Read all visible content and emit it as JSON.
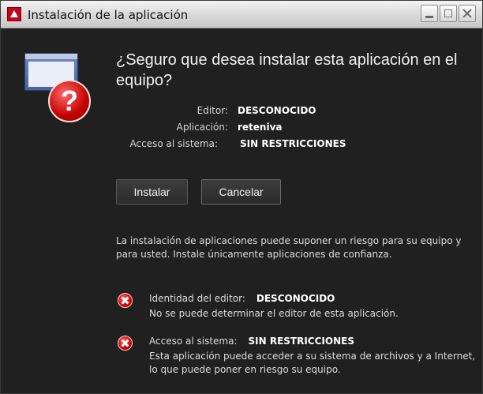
{
  "window": {
    "title": "Instalación de la aplicación"
  },
  "prompt": {
    "question": "¿Seguro que desea instalar esta aplicación en el equipo?"
  },
  "details": [
    {
      "label": "Editor:",
      "value": "DESCONOCIDO"
    },
    {
      "label": "Aplicación:",
      "value": "reteniva"
    },
    {
      "label": "Acceso al sistema:",
      "value": "SIN RESTRICCIONES"
    }
  ],
  "buttons": {
    "install": "Instalar",
    "cancel": "Cancelar"
  },
  "warning": "La instalación de aplicaciones puede suponer un riesgo para su equipo y para usted. Instale únicamente aplicaciones de confianza.",
  "risks": [
    {
      "label": "Identidad del editor:",
      "value": "DESCONOCIDO",
      "description": "No se puede determinar el editor de esta aplicación."
    },
    {
      "label": "Acceso al sistema:",
      "value": "SIN RESTRICCIONES",
      "description": "Esta aplicación puede acceder a su sistema de archivos y a Internet, lo que puede poner en riesgo su equipo."
    }
  ],
  "icons": {
    "app": "adobe-air-icon",
    "main": "install-warning-icon",
    "risk": "error-icon"
  },
  "colors": {
    "background": "#202020",
    "accent_red": "#c40000"
  }
}
